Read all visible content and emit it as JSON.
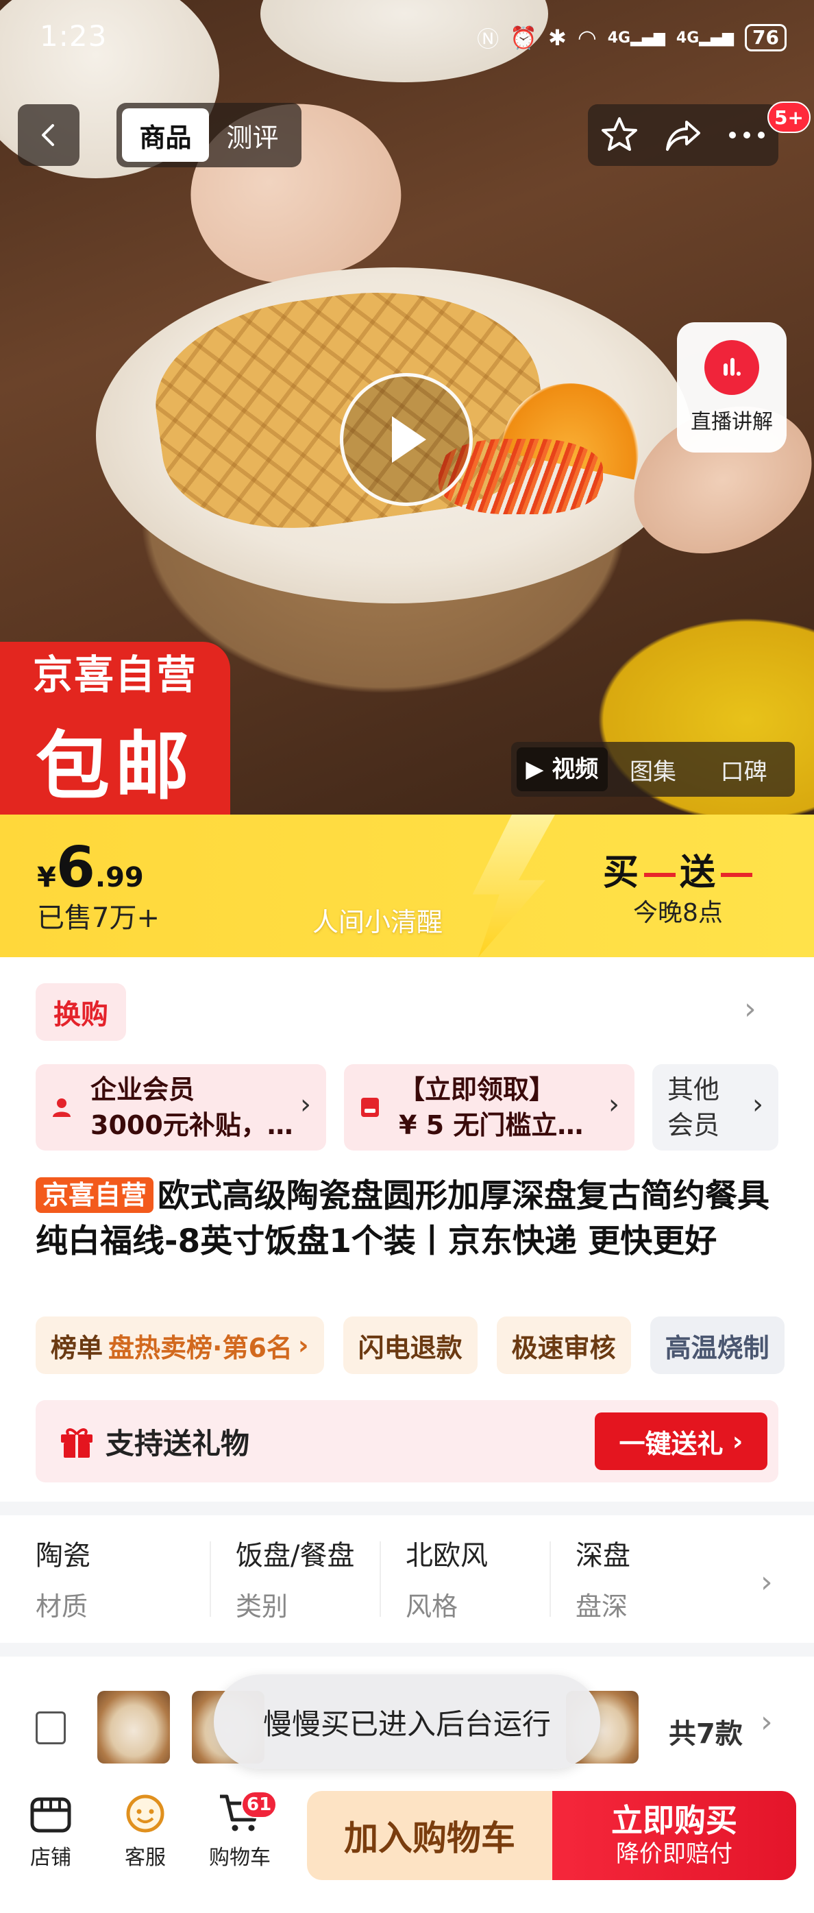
{
  "status_bar": {
    "time": "1:23",
    "network1": "4G",
    "network2": "4G",
    "battery": "76"
  },
  "nav": {
    "tabs": [
      {
        "label": "商品",
        "active": true
      },
      {
        "label": "测评",
        "active": false
      }
    ],
    "more_badge": "5+"
  },
  "hero": {
    "live_label": "直播讲解",
    "promo_line1": "京喜自营",
    "promo_line2": "包邮",
    "media_tabs": [
      {
        "label": "视频",
        "active": true
      },
      {
        "label": "图集",
        "active": false
      },
      {
        "label": "口碑",
        "active": false
      }
    ]
  },
  "price": {
    "currency": "¥",
    "integer": "6",
    "decimal": ".99",
    "sold": "已售7万+",
    "slogan": "人间小清醒",
    "deal_a": "买",
    "deal_b": "送",
    "deal_sub": "今晚8点"
  },
  "swap": {
    "label": "换购"
  },
  "coupons": [
    {
      "line1": "企业会员",
      "line2": "3000元补贴，…"
    },
    {
      "line1": "【立即领取】",
      "line2": "¥ 5 无门槛立…"
    },
    {
      "line1": "其他",
      "line2": "会员"
    }
  ],
  "product": {
    "tag": "京喜自营",
    "title": "欧式高级陶瓷盘圆形加厚深盘复古简约餐具 纯白福线-8英寸饭盘1个装丨京东快递 更快更好"
  },
  "pills": [
    {
      "label": "榜单",
      "extra": "盘热卖榜·第6名"
    },
    {
      "label": "闪电退款"
    },
    {
      "label": "极速审核"
    },
    {
      "label": "高温烧制"
    }
  ],
  "gift": {
    "label": "支持送礼物",
    "button": "一键送礼"
  },
  "attributes": [
    {
      "value": "陶瓷",
      "key": "材质"
    },
    {
      "value": "饭盘/餐盘",
      "key": "类别"
    },
    {
      "value": "北欧风",
      "key": "风格"
    },
    {
      "value": "深盘",
      "key": "盘深"
    }
  ],
  "sku": {
    "count": "共7款",
    "toast": "慢慢买已进入后台运行"
  },
  "bottom": {
    "store": "店铺",
    "service": "客服",
    "cart": "购物车",
    "cart_badge": "61",
    "add_cart": "加入购物车",
    "buy_now": "立即购买",
    "buy_now_sub": "降价即赔付"
  },
  "colors": {
    "accent_red": "#e4151f",
    "price_yellow": "#ffd83b"
  }
}
